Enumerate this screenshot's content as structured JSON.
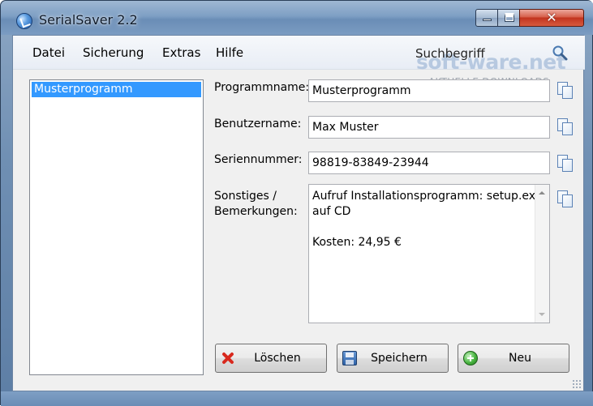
{
  "window": {
    "title": "SerialSaver 2.2",
    "icon": "app-icon",
    "controls": {
      "minimize": "minimize",
      "maximize": "maximize",
      "close": "✕"
    }
  },
  "menu": {
    "items": [
      {
        "label": "Datei"
      },
      {
        "label": "Sicherung"
      },
      {
        "label": "Extras"
      },
      {
        "label": "Hilfe"
      }
    ],
    "search_value": "Suchbegriff",
    "search_icon": "magnifier-icon"
  },
  "watermark": {
    "logo": "soft-ware.net",
    "tagline": "AKTUELLE DOWNLOADS"
  },
  "program_list": {
    "items": [
      "Musterprogramm"
    ],
    "selected_index": 0
  },
  "fields": {
    "program_name": {
      "label": "Programmname:",
      "value": "Musterprogramm"
    },
    "username": {
      "label": "Benutzername:",
      "value": "Max Muster"
    },
    "serial": {
      "label": "Seriennummer:",
      "value": "98819-83849-23944"
    },
    "notes": {
      "label_line1": "Sonstiges /",
      "label_line2": "Bemerkungen:",
      "lines": [
        "Aufruf Installationsprogramm: setup.exe",
        "auf CD",
        "",
        "Kosten: 24,95 €"
      ]
    }
  },
  "buttons": {
    "delete": {
      "label": "Löschen",
      "icon": "red-x-icon"
    },
    "save": {
      "label": "Speichern",
      "icon": "floppy-disk-icon"
    },
    "new": {
      "label": "Neu",
      "icon": "green-plus-icon"
    }
  },
  "colors": {
    "selection": "#3399ff",
    "title_bar": "#7e9fc4",
    "close_button": "#c2341f"
  }
}
